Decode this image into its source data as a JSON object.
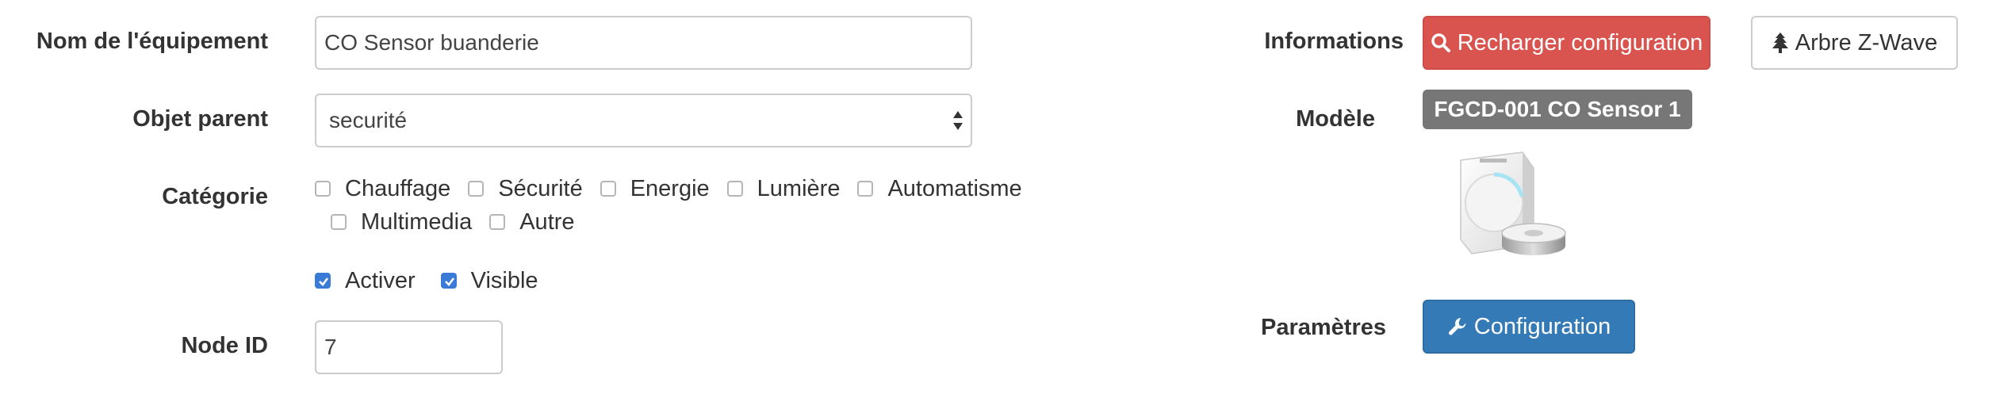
{
  "form": {
    "equipment_name_label": "Nom de l'équipement",
    "equipment_name_value": "CO Sensor buanderie",
    "parent_object_label": "Objet parent",
    "parent_object_value": "securité",
    "category_label": "Catégorie",
    "categories": [
      {
        "label": "Chauffage",
        "checked": false
      },
      {
        "label": "Sécurité",
        "checked": false
      },
      {
        "label": "Energie",
        "checked": false
      },
      {
        "label": "Lumière",
        "checked": false
      },
      {
        "label": "Automatisme",
        "checked": false
      },
      {
        "label": "Multimedia",
        "checked": false
      },
      {
        "label": "Autre",
        "checked": false
      }
    ],
    "activate_label": "Activer",
    "activate_checked": true,
    "visible_label": "Visible",
    "visible_checked": true,
    "node_id_label": "Node ID",
    "node_id_value": "7"
  },
  "info": {
    "informations_label": "Informations",
    "reload_config_button": "Recharger configuration",
    "zwave_tree_button": "Arbre Z-Wave",
    "model_label": "Modèle",
    "model_badge": "FGCD-001 CO Sensor 1",
    "parameters_label": "Paramètres",
    "configuration_button": "Configuration"
  },
  "colors": {
    "danger": "#d9534f",
    "primary": "#337ab7",
    "badge": "#777777",
    "checkbox_checked": "#3b7bd8"
  },
  "icons": {
    "reload": "search-icon",
    "tree": "tree-icon",
    "configuration": "wrench-icon",
    "select": "select-arrows-icon",
    "checkbox": "checkmark-icon"
  }
}
